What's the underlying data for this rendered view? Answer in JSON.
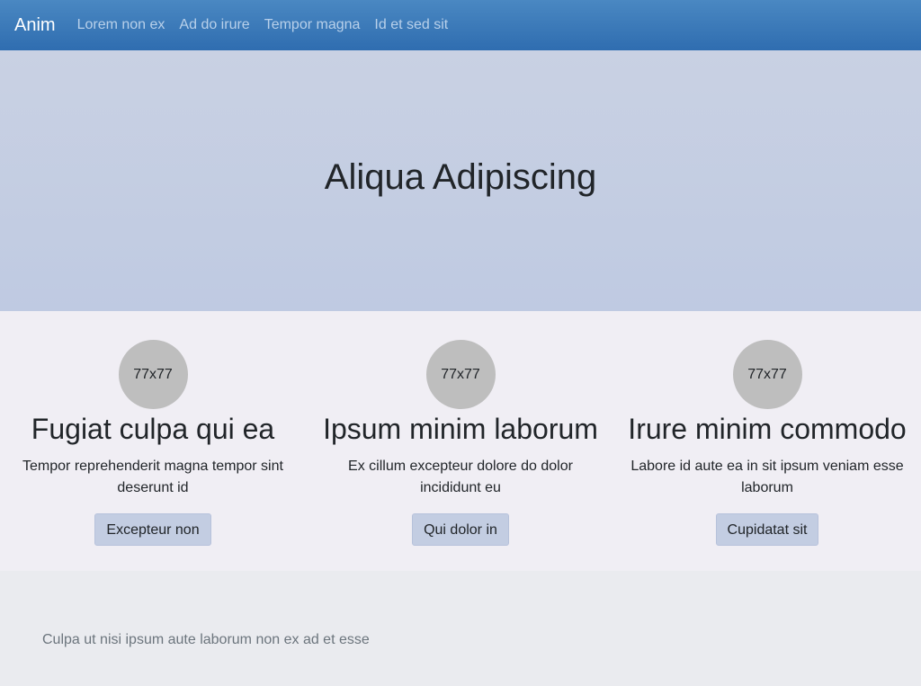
{
  "navbar": {
    "brand": "Anim",
    "links": [
      "Lorem non ex",
      "Ad do irure",
      "Tempor magna",
      "Id et sed sit"
    ]
  },
  "hero": {
    "title": "Aliqua Adipiscing"
  },
  "features": [
    {
      "image_label": "77x77",
      "title": "Fugiat culpa qui ea",
      "text": "Tempor reprehenderit magna tempor sint deserunt id",
      "button": "Excepteur non"
    },
    {
      "image_label": "77x77",
      "title": "Ipsum minim laborum",
      "text": "Ex cillum excepteur dolore do dolor incididunt eu",
      "button": "Qui dolor in"
    },
    {
      "image_label": "77x77",
      "title": "Irure minim commodo",
      "text": "Labore id aute ea in sit ipsum veniam esse laborum",
      "button": "Cupidatat sit"
    }
  ],
  "footer": {
    "text": "Culpa ut nisi ipsum aute laborum non ex ad et esse"
  },
  "colors": {
    "navbar": "#3a7abb",
    "hero": "#c5cee3",
    "button": "#c3cde2",
    "avatar": "#bebebe"
  }
}
